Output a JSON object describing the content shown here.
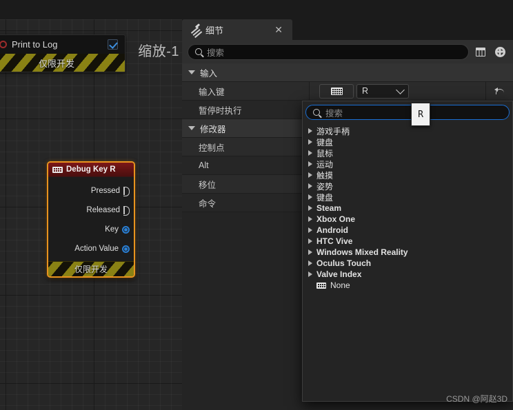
{
  "graph": {
    "zoom_label": "缩放-1",
    "print_node": {
      "label": "Print to Log",
      "checkbox_checked": true,
      "dev_only": "仅限开发",
      "pin_icon": "exec-out-pin-icon",
      "check_icon": "checkmark-icon"
    },
    "key_node": {
      "title": "Debug Key R",
      "title_icon": "keyboard-icon",
      "dev_only": "仅限开发",
      "pins": [
        {
          "label": "Pressed",
          "type": "exec"
        },
        {
          "label": "Released",
          "type": "exec"
        },
        {
          "label": "Key",
          "type": "data"
        },
        {
          "label": "Action Value",
          "type": "data"
        }
      ]
    }
  },
  "details": {
    "tab": {
      "title": "细节",
      "icon": "details-pencil-icon",
      "close_label": "✕"
    },
    "search": {
      "placeholder": "搜索",
      "icon": "search-icon",
      "grid_icon": "grid-view-icon",
      "settings_icon": "gear-icon"
    },
    "sections": [
      {
        "label": "输入",
        "rows": [
          {
            "name": "输入键",
            "value_kind": "key-picker",
            "keyboard_icon": "keyboard-icon",
            "selected_key": "R",
            "reset_icon": "undo-arrow-icon"
          },
          {
            "name": "暂停时执行",
            "value_kind": "checkbox"
          }
        ]
      },
      {
        "label": "修改器",
        "rows": [
          {
            "name": "控制点",
            "value_kind": "empty"
          },
          {
            "name": "Alt",
            "value_kind": "empty"
          },
          {
            "name": "移位",
            "value_kind": "empty"
          },
          {
            "name": "命令",
            "value_kind": "empty"
          }
        ]
      }
    ]
  },
  "dropdown": {
    "search_placeholder": "搜索",
    "search_icon": "search-icon",
    "items": [
      {
        "label": "游戏手柄",
        "expandable": true,
        "bold": false
      },
      {
        "label": "键盘",
        "expandable": true,
        "bold": false
      },
      {
        "label": "鼠标",
        "expandable": true,
        "bold": false
      },
      {
        "label": "运动",
        "expandable": true,
        "bold": false
      },
      {
        "label": "触摸",
        "expandable": true,
        "bold": false
      },
      {
        "label": "姿势",
        "expandable": true,
        "bold": false
      },
      {
        "label": "键盘",
        "expandable": true,
        "bold": false
      },
      {
        "label": "Steam",
        "expandable": true,
        "bold": true
      },
      {
        "label": "Xbox One",
        "expandable": true,
        "bold": true
      },
      {
        "label": "Android",
        "expandable": true,
        "bold": true
      },
      {
        "label": "HTC Vive",
        "expandable": true,
        "bold": true
      },
      {
        "label": "Windows Mixed Reality",
        "expandable": true,
        "bold": true
      },
      {
        "label": "Oculus Touch",
        "expandable": true,
        "bold": true
      },
      {
        "label": "Valve Index",
        "expandable": true,
        "bold": true
      },
      {
        "label": "None",
        "expandable": false,
        "bold": false,
        "icon": "keyboard-icon"
      }
    ]
  },
  "key_badge": {
    "text": "R"
  },
  "watermark": {
    "text": "CSDN @阿赵3D"
  },
  "colors": {
    "accent_orange": "#e8931e",
    "node_header_red": "#621313",
    "exec_pin": "#c8c8c8",
    "data_pin_blue": "#2a7fd4",
    "focus_blue": "#1a6fd4",
    "dev_only_yellow": "#8a8214"
  }
}
